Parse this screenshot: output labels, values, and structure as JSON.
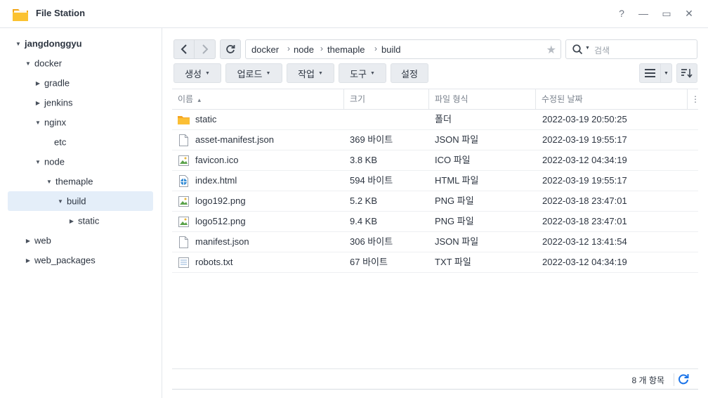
{
  "window": {
    "title": "File Station",
    "help_glyph": "?",
    "minimize_glyph": "—",
    "maximize_glyph": "▭",
    "close_glyph": "✕"
  },
  "sidebar": {
    "root": "jangdonggyu",
    "items": [
      {
        "label": "docker"
      },
      {
        "label": "gradle"
      },
      {
        "label": "jenkins"
      },
      {
        "label": "nginx"
      },
      {
        "label": "etc"
      },
      {
        "label": "node"
      },
      {
        "label": "themaple"
      },
      {
        "label": "build"
      },
      {
        "label": "static"
      },
      {
        "label": "web"
      },
      {
        "label": "web_packages"
      }
    ],
    "selected": "build"
  },
  "path": {
    "crumbs": [
      "docker",
      "node",
      "themaple",
      "build"
    ],
    "separator": "›"
  },
  "search": {
    "placeholder": "검색"
  },
  "actions": {
    "create": "생성",
    "upload": "업로드",
    "tools_action": "작업",
    "tools": "도구",
    "settings": "설정"
  },
  "table": {
    "headers": {
      "name": "이름",
      "size": "크기",
      "type": "파일 형식",
      "modified": "수정된 날짜"
    },
    "sort_glyph": "▴",
    "rows": [
      {
        "icon": "folder-icon",
        "name": "static",
        "size": "",
        "type": "폴더",
        "modified": "2022-03-19 20:50:25"
      },
      {
        "icon": "file-icon",
        "name": "asset-manifest.json",
        "size": "369 바이트",
        "type": "JSON 파일",
        "modified": "2022-03-19 19:55:17"
      },
      {
        "icon": "image-icon",
        "name": "favicon.ico",
        "size": "3.8 KB",
        "type": "ICO 파일",
        "modified": "2022-03-12 04:34:19"
      },
      {
        "icon": "html-icon",
        "name": "index.html",
        "size": "594 바이트",
        "type": "HTML 파일",
        "modified": "2022-03-19 19:55:17"
      },
      {
        "icon": "image-icon",
        "name": "logo192.png",
        "size": "5.2 KB",
        "type": "PNG 파일",
        "modified": "2022-03-18 23:47:01"
      },
      {
        "icon": "image-icon",
        "name": "logo512.png",
        "size": "9.4 KB",
        "type": "PNG 파일",
        "modified": "2022-03-18 23:47:01"
      },
      {
        "icon": "file-icon",
        "name": "manifest.json",
        "size": "306 바이트",
        "type": "JSON 파일",
        "modified": "2022-03-12 13:41:54"
      },
      {
        "icon": "text-icon",
        "name": "robots.txt",
        "size": "67 바이트",
        "type": "TXT 파일",
        "modified": "2022-03-12 04:34:19"
      }
    ]
  },
  "footer": {
    "count": "8 개 항목"
  },
  "colors": {
    "accent": "#1a73e8",
    "selection": "#e4eef9",
    "folder": "#f5a623"
  }
}
